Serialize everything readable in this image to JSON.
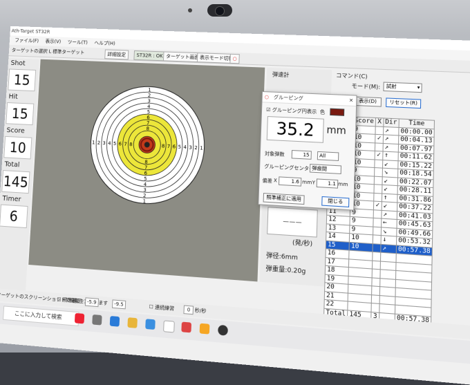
{
  "window": {
    "title": "Ath-Target ST32R"
  },
  "menu": [
    "ファイル(F)",
    "表示(V)",
    "ツール(T)",
    "ヘルプ(H)"
  ],
  "toolbar": {
    "target_label": "ターゲットの選択",
    "target_value": "L 標準ターゲット",
    "detail": "詳細設定",
    "st": "ST32R : OK",
    "target_screen": "ターゲット画面",
    "display_mode": "表示モード切替"
  },
  "left": {
    "shot_label": "Shot",
    "shot_value": "15",
    "hit_label": "Hit",
    "hit_value": "15",
    "score_label": "Score",
    "score_value": "10",
    "total_label": "Total",
    "total_value": "145",
    "timer_label": "Timer",
    "timer_value": "6"
  },
  "ring_numbers_h": [
    "1",
    "2",
    "3",
    "4",
    "5",
    "6",
    "7",
    "8",
    "8",
    "7",
    "6",
    "5",
    "4",
    "3",
    "2",
    "1"
  ],
  "ring_numbers_v": [
    "1",
    "2",
    "3",
    "4",
    "5",
    "6",
    "7",
    "8",
    "8",
    "7",
    "6",
    "5",
    "4",
    "3",
    "2",
    "1"
  ],
  "stats": {
    "header": "弾速計",
    "rate": "(発/秒)",
    "caliber": "弾径:6mm",
    "weight": "弾重量:0.20g"
  },
  "command": {
    "label": "コマンド(C)",
    "mode_label": "モード(M):",
    "mode_value": "試射",
    "view_btn": "表示(D)",
    "reset_btn": "リセット(R)"
  },
  "table": {
    "headers": [
      "Shot",
      "Score",
      "X",
      "Dir",
      "Time"
    ],
    "rows": [
      [
        "1",
        "9",
        "",
        "↗",
        "00:00.00"
      ],
      [
        "2",
        "10",
        "✓",
        "↗",
        "00:04.13"
      ],
      [
        "3",
        "10",
        "",
        "↗",
        "00:07.97"
      ],
      [
        "4",
        "10",
        "✓",
        "↑",
        "00:11.62"
      ],
      [
        "5",
        "10",
        "",
        "↙",
        "00:15.22"
      ],
      [
        "6",
        "9",
        "",
        "↘",
        "00:18.54"
      ],
      [
        "7",
        "10",
        "",
        "↙",
        "00:22.07"
      ],
      [
        "8",
        "10",
        "",
        "↙",
        "00:28.11"
      ],
      [
        "9",
        "10",
        "",
        "↑",
        "00:31.86"
      ],
      [
        "10",
        "10",
        "✓",
        "↙",
        "00:37.22"
      ],
      [
        "11",
        "9",
        "",
        "↗",
        "00:41.03"
      ],
      [
        "12",
        "9",
        "",
        "←",
        "00:45.63"
      ],
      [
        "13",
        "9",
        "",
        "↘",
        "00:49.66"
      ],
      [
        "14",
        "10",
        "",
        "↓",
        "00:53.32"
      ],
      [
        "15",
        "10",
        "",
        "↗",
        "00:57.38"
      ],
      [
        "16",
        "",
        "",
        "",
        ""
      ],
      [
        "17",
        "",
        "",
        "",
        ""
      ],
      [
        "18",
        "",
        "",
        "",
        ""
      ],
      [
        "19",
        "",
        "",
        "",
        ""
      ],
      [
        "20",
        "",
        "",
        "",
        ""
      ],
      [
        "21",
        "",
        "",
        "",
        ""
      ],
      [
        "22",
        "",
        "",
        "",
        ""
      ]
    ],
    "total": [
      "Total",
      "145",
      "3",
      "",
      "00:57.38"
    ],
    "selected_index": 14
  },
  "dialog": {
    "title": "グルーピング",
    "show_circle": "グルーピング円表示",
    "color_label": "色",
    "value": "35.2",
    "unit": "mm",
    "target_shots_label": "対象弾数",
    "target_shots": "15",
    "all": "All",
    "center_label": "グルーピングセンター",
    "center_value": "弾痕間",
    "offset_label": "偏差",
    "x_label": "X",
    "x_value": "1.6",
    "y_label": "Y",
    "y_value": "1.1",
    "mm": "mm",
    "apply": "照準補正に適用",
    "close": "閉じる"
  },
  "statusbar": {
    "text": "ターゲットのスクリーンショットで撮影を実施します",
    "correction": "照準補正",
    "x": "-5.9",
    "y": "-9.5",
    "continuous": "連続練習",
    "interval": "0",
    "unit_s": "秒/秒"
  },
  "taskbar": {
    "search": "ここに入力して検索"
  },
  "colors": {
    "target_yellow": "#ece63a",
    "selection": "#1f5fc9",
    "panel_bg": "#8c8c84",
    "circle_color": "#7a1a10"
  }
}
